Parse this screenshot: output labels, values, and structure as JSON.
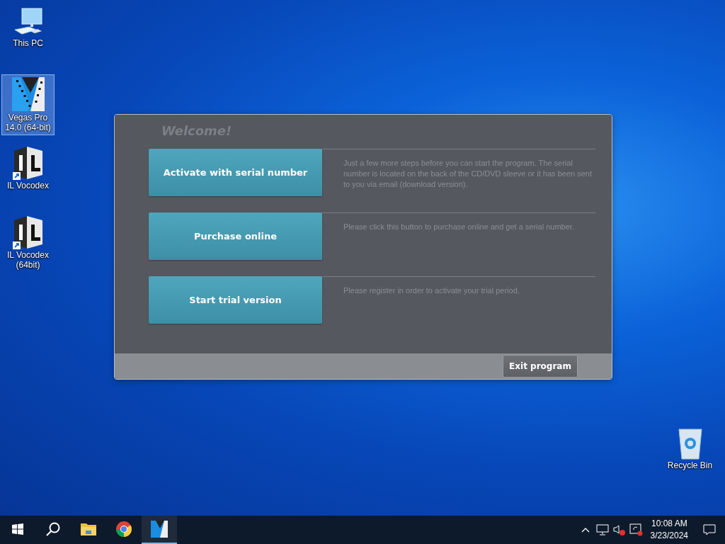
{
  "desktop_icons": [
    {
      "kind": "pc",
      "label": "This PC",
      "selected": false
    },
    {
      "kind": "vegas",
      "label": "Vegas Pro 14.0 (64-bit)",
      "selected": true
    },
    {
      "kind": "vocodex",
      "label": "IL Vocodex",
      "selected": false
    },
    {
      "kind": "vocodex",
      "label": "IL Vocodex (64bit)",
      "selected": false
    }
  ],
  "recycle_bin": {
    "label": "Recycle Bin"
  },
  "dialog": {
    "title": "Welcome!",
    "options": [
      {
        "label": "Activate with serial number",
        "description": "Just a few more steps before you can start the program. The serial number is located on the back of the CD/DVD sleeve or it has been sent to you via email (download version)."
      },
      {
        "label": "Purchase online",
        "description": "Please click this button to purchase online and get a serial number."
      },
      {
        "label": "Start trial version",
        "description": "Please register in order to activate your trial period."
      }
    ],
    "exit_button": "Exit program"
  },
  "taskbar": {
    "apps": [
      {
        "kind": "explorer",
        "selected": false
      },
      {
        "kind": "chrome",
        "selected": false
      },
      {
        "kind": "vegas",
        "selected": true
      }
    ],
    "clock": {
      "time": "10:08 AM",
      "date": "3/23/2024"
    }
  }
}
